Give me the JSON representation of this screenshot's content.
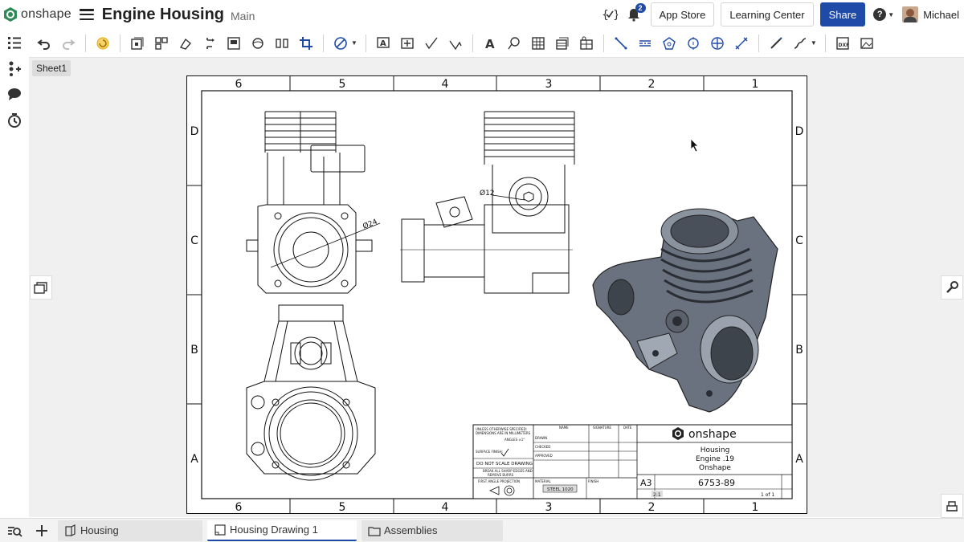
{
  "app": {
    "name": "onshape",
    "brand_color": "#2e8b57",
    "accent": "#1f4aa8"
  },
  "document": {
    "title": "Engine Housing",
    "branch": "Main"
  },
  "header": {
    "notifications_count": "2",
    "app_store_label": "App Store",
    "learning_center_label": "Learning Center",
    "share_label": "Share",
    "help_label": "?",
    "user_name": "Michael"
  },
  "sheet_tab": {
    "label": "Sheet1"
  },
  "drawing": {
    "zone_cols": [
      "6",
      "5",
      "4",
      "3",
      "2",
      "1"
    ],
    "zone_rows": [
      "D",
      "C",
      "B",
      "A"
    ],
    "dim_left": "Ø24",
    "dim_mid": "Ø12",
    "title_block": {
      "logo_text": "onshape",
      "notes": [
        "UNLESS OTHERWISE SPECIFIED:",
        "DIMENSIONS ARE IN MILLIMETERS",
        "ANGLES ±1°"
      ],
      "surface_finish": "SURFACE FINISH:",
      "do_not_scale": "DO NOT SCALE DRAWING",
      "break_edges": [
        "BREAK ALL SHARP EDGES AND",
        "REMOVE BURRS"
      ],
      "projection": "FIRST ANGLE PROJECTION",
      "rows": [
        "DRAWN",
        "CHECKED",
        "APPROVED"
      ],
      "headers": [
        "NAME",
        "SIGNATURE",
        "DATE"
      ],
      "material_label": "MATERIAL",
      "material": "STEEL 1020",
      "finish_label": "FINISH",
      "title_lines": [
        "Housing",
        "Engine .19",
        "Onshape"
      ],
      "size": "A3",
      "dwg_no": "6753-89",
      "scale": "2:1",
      "sheet": "1 of 1"
    }
  },
  "tabs": [
    {
      "label": "Housing",
      "icon": "part-studio-icon"
    },
    {
      "label": "Housing Drawing 1",
      "icon": "drawing-icon"
    },
    {
      "label": "Assemblies",
      "icon": "folder-icon"
    }
  ]
}
